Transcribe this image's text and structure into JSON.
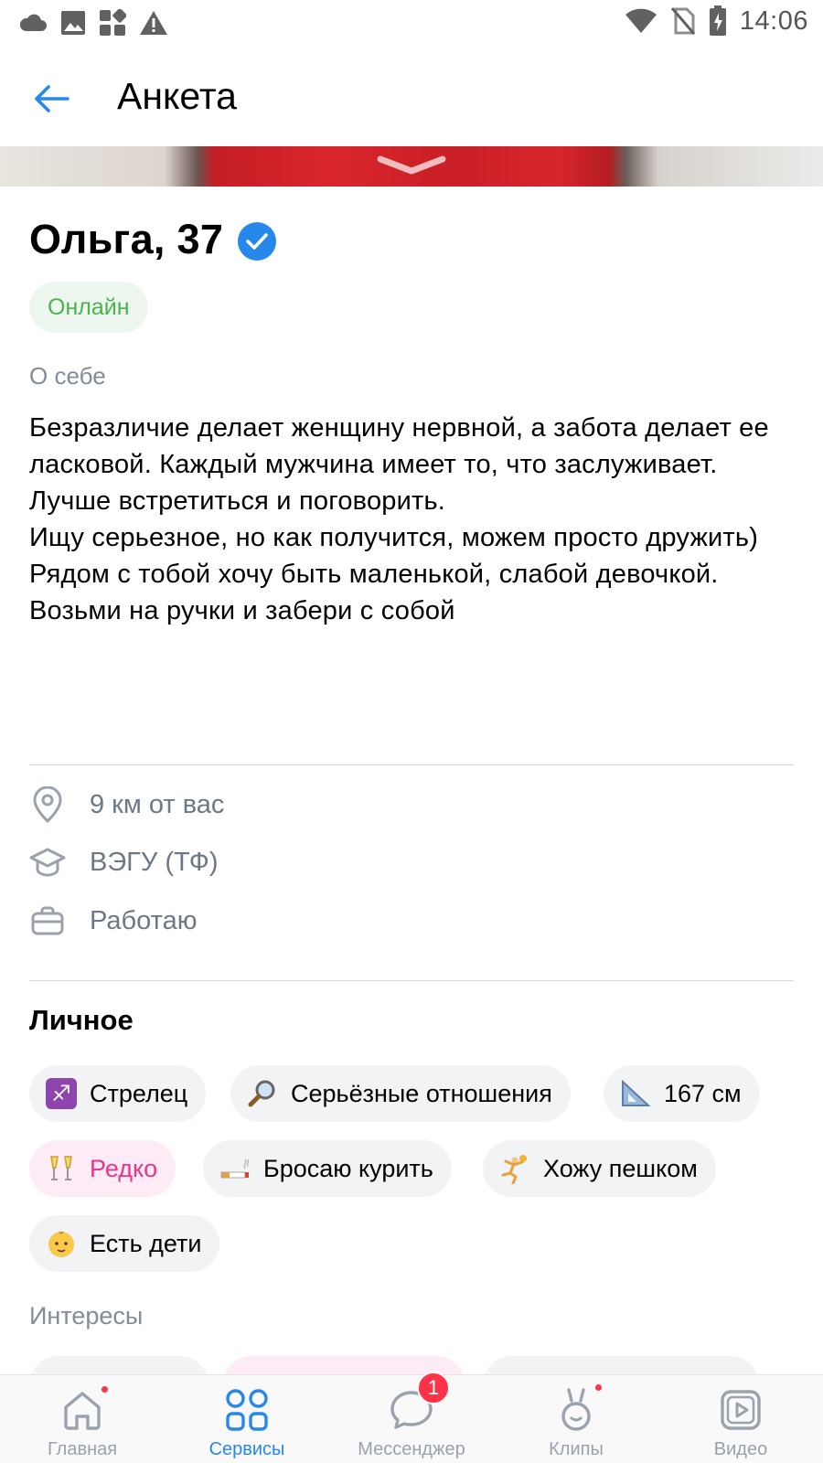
{
  "status_bar": {
    "time": "14:06",
    "left_icons": [
      "cloud-icon",
      "image-icon",
      "apps-icon",
      "warning-icon"
    ],
    "right_icons": [
      "wifi-icon",
      "no-sim-icon",
      "battery-charging-icon"
    ]
  },
  "header": {
    "title": "Анкета",
    "back_icon": "arrow-left-icon"
  },
  "profile": {
    "name_age": "Ольга, 37",
    "verified_icon": "verified-check-icon",
    "status": "Онлайн",
    "about_label": "О себе",
    "about_text": "Безразличие делает женщину нервной, а забота делает ее ласковой. Каждый мужчина имеет то, что заслуживает.\nЛучше встретиться и поговорить.\nИщу серьезное, но как получится, можем просто дружить)\nРядом с тобой хочу быть маленькой, слабой девочкой.\nВозьми на ручки и забери с собой",
    "info": [
      {
        "icon": "location-pin-icon",
        "text": "9 км от вас"
      },
      {
        "icon": "graduation-cap-icon",
        "text": "ВЭГУ (ТФ)"
      },
      {
        "icon": "briefcase-icon",
        "text": "Работаю"
      }
    ]
  },
  "personal": {
    "title": "Личное",
    "chips": [
      {
        "emoji": "♐",
        "label": "Стрелец"
      },
      {
        "emoji": "🔎",
        "label": "Серьёзные отношения"
      },
      {
        "emoji": "📐",
        "label": "167 см"
      },
      {
        "emoji": "🥂",
        "label": "Редко"
      },
      {
        "emoji": "🚬",
        "label": "Бросаю курить"
      },
      {
        "emoji": "🤾",
        "label": "Хожу пешком"
      },
      {
        "emoji": "👶",
        "label": "Есть дети"
      }
    ]
  },
  "interests": {
    "title": "Интересы"
  },
  "bottom_nav": {
    "items": [
      {
        "label": "Главная",
        "icon": "home-icon"
      },
      {
        "label": "Сервисы",
        "icon": "services-grid-icon"
      },
      {
        "label": "Мессенджер",
        "icon": "chat-bubble-icon",
        "badge": "1"
      },
      {
        "label": "Клипы",
        "icon": "clips-icon"
      },
      {
        "label": "Видео",
        "icon": "video-play-icon"
      }
    ],
    "active": "Сервисы"
  },
  "colors": {
    "accent": "#2688eb",
    "online": "#4bb34b",
    "pink": "#e8368e",
    "notification": "#ff3347"
  }
}
